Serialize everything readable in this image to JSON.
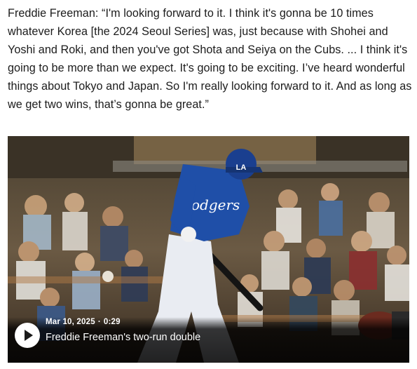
{
  "quote": {
    "text": "Freddie Freeman: “I'm looking forward to it. I think it's gonna be 10 times whatever Korea [the 2024 Seoul Series] was, just because with Shohei and Yoshi and Roki, and then you've got Shota and Seiya on the Cubs. ... I think it's going to be more than we expect. It's going to be exciting. I’ve heard wonderful things about Tokyo and Japan. So I'm really looking forward to it. And as long as we get two wins, that’s gonna be great.”"
  },
  "video": {
    "date": "Mar 10, 2025",
    "separator": "·",
    "duration": "0:29",
    "title": "Freddie Freeman's two-run double",
    "jersey_text": "odgers",
    "helmet_logo": "LA",
    "play_icon": "play-icon",
    "colors": {
      "jersey": "#1f4fa8",
      "pants": "#e9ecf2",
      "overlay": "#000000"
    }
  }
}
